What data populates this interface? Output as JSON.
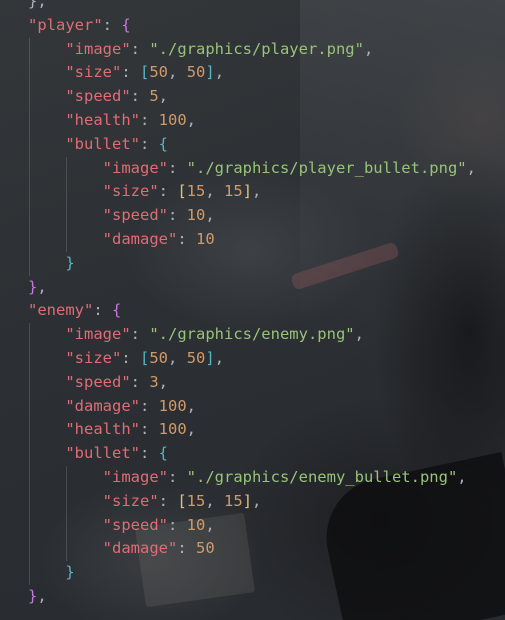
{
  "editor": {
    "lines": [
      {
        "indent": 0,
        "tokens": [
          {
            "t": "p",
            "v": "},"
          }
        ]
      },
      {
        "indent": 0,
        "tokens": [
          {
            "t": "k",
            "v": "\"player\""
          },
          {
            "t": "p",
            "v": ": "
          },
          {
            "t": "b1",
            "v": "{"
          }
        ]
      },
      {
        "indent": 1,
        "tokens": [
          {
            "t": "k",
            "v": "\"image\""
          },
          {
            "t": "p",
            "v": ": "
          },
          {
            "t": "s",
            "v": "\"./graphics/player.png\""
          },
          {
            "t": "p",
            "v": ","
          }
        ]
      },
      {
        "indent": 1,
        "tokens": [
          {
            "t": "k",
            "v": "\"size\""
          },
          {
            "t": "p",
            "v": ": "
          },
          {
            "t": "b2",
            "v": "["
          },
          {
            "t": "n",
            "v": "50"
          },
          {
            "t": "p",
            "v": ", "
          },
          {
            "t": "n",
            "v": "50"
          },
          {
            "t": "b2",
            "v": "]"
          },
          {
            "t": "p",
            "v": ","
          }
        ]
      },
      {
        "indent": 1,
        "tokens": [
          {
            "t": "k",
            "v": "\"speed\""
          },
          {
            "t": "p",
            "v": ": "
          },
          {
            "t": "n",
            "v": "5"
          },
          {
            "t": "p",
            "v": ","
          }
        ]
      },
      {
        "indent": 1,
        "tokens": [
          {
            "t": "k",
            "v": "\"health\""
          },
          {
            "t": "p",
            "v": ": "
          },
          {
            "t": "n",
            "v": "100"
          },
          {
            "t": "p",
            "v": ","
          }
        ]
      },
      {
        "indent": 1,
        "tokens": [
          {
            "t": "k",
            "v": "\"bullet\""
          },
          {
            "t": "p",
            "v": ": "
          },
          {
            "t": "b2",
            "v": "{"
          }
        ]
      },
      {
        "indent": 2,
        "tokens": [
          {
            "t": "k",
            "v": "\"image\""
          },
          {
            "t": "p",
            "v": ": "
          },
          {
            "t": "s",
            "v": "\"./graphics/player_bullet.png\""
          },
          {
            "t": "p",
            "v": ","
          }
        ]
      },
      {
        "indent": 2,
        "tokens": [
          {
            "t": "k",
            "v": "\"size\""
          },
          {
            "t": "p",
            "v": ": "
          },
          {
            "t": "b3",
            "v": "["
          },
          {
            "t": "n",
            "v": "15"
          },
          {
            "t": "p",
            "v": ", "
          },
          {
            "t": "n",
            "v": "15"
          },
          {
            "t": "b3",
            "v": "]"
          },
          {
            "t": "p",
            "v": ","
          }
        ]
      },
      {
        "indent": 2,
        "tokens": [
          {
            "t": "k",
            "v": "\"speed\""
          },
          {
            "t": "p",
            "v": ": "
          },
          {
            "t": "n",
            "v": "10"
          },
          {
            "t": "p",
            "v": ","
          }
        ]
      },
      {
        "indent": 2,
        "tokens": [
          {
            "t": "k",
            "v": "\"damage\""
          },
          {
            "t": "p",
            "v": ": "
          },
          {
            "t": "n",
            "v": "10"
          }
        ]
      },
      {
        "indent": 1,
        "tokens": [
          {
            "t": "b2",
            "v": "}"
          }
        ]
      },
      {
        "indent": 0,
        "tokens": [
          {
            "t": "b1",
            "v": "}"
          },
          {
            "t": "p",
            "v": ","
          }
        ]
      },
      {
        "indent": 0,
        "tokens": [
          {
            "t": "k",
            "v": "\"enemy\""
          },
          {
            "t": "p",
            "v": ": "
          },
          {
            "t": "b1",
            "v": "{"
          }
        ]
      },
      {
        "indent": 1,
        "tokens": [
          {
            "t": "k",
            "v": "\"image\""
          },
          {
            "t": "p",
            "v": ": "
          },
          {
            "t": "s",
            "v": "\"./graphics/enemy.png\""
          },
          {
            "t": "p",
            "v": ","
          }
        ]
      },
      {
        "indent": 1,
        "tokens": [
          {
            "t": "k",
            "v": "\"size\""
          },
          {
            "t": "p",
            "v": ": "
          },
          {
            "t": "b2",
            "v": "["
          },
          {
            "t": "n",
            "v": "50"
          },
          {
            "t": "p",
            "v": ", "
          },
          {
            "t": "n",
            "v": "50"
          },
          {
            "t": "b2",
            "v": "]"
          },
          {
            "t": "p",
            "v": ","
          }
        ]
      },
      {
        "indent": 1,
        "tokens": [
          {
            "t": "k",
            "v": "\"speed\""
          },
          {
            "t": "p",
            "v": ": "
          },
          {
            "t": "n",
            "v": "3"
          },
          {
            "t": "p",
            "v": ","
          }
        ]
      },
      {
        "indent": 1,
        "tokens": [
          {
            "t": "k",
            "v": "\"damage\""
          },
          {
            "t": "p",
            "v": ": "
          },
          {
            "t": "n",
            "v": "100"
          },
          {
            "t": "p",
            "v": ","
          }
        ]
      },
      {
        "indent": 1,
        "tokens": [
          {
            "t": "k",
            "v": "\"health\""
          },
          {
            "t": "p",
            "v": ": "
          },
          {
            "t": "n",
            "v": "100"
          },
          {
            "t": "p",
            "v": ","
          }
        ]
      },
      {
        "indent": 1,
        "tokens": [
          {
            "t": "k",
            "v": "\"bullet\""
          },
          {
            "t": "p",
            "v": ": "
          },
          {
            "t": "b2",
            "v": "{"
          }
        ]
      },
      {
        "indent": 2,
        "tokens": [
          {
            "t": "k",
            "v": "\"image\""
          },
          {
            "t": "p",
            "v": ": "
          },
          {
            "t": "s",
            "v": "\"./graphics/enemy_bullet.png\""
          },
          {
            "t": "p",
            "v": ","
          }
        ]
      },
      {
        "indent": 2,
        "tokens": [
          {
            "t": "k",
            "v": "\"size\""
          },
          {
            "t": "p",
            "v": ": "
          },
          {
            "t": "b3",
            "v": "["
          },
          {
            "t": "n",
            "v": "15"
          },
          {
            "t": "p",
            "v": ", "
          },
          {
            "t": "n",
            "v": "15"
          },
          {
            "t": "b3",
            "v": "]"
          },
          {
            "t": "p",
            "v": ","
          }
        ]
      },
      {
        "indent": 2,
        "tokens": [
          {
            "t": "k",
            "v": "\"speed\""
          },
          {
            "t": "p",
            "v": ": "
          },
          {
            "t": "n",
            "v": "10"
          },
          {
            "t": "p",
            "v": ","
          }
        ]
      },
      {
        "indent": 2,
        "tokens": [
          {
            "t": "k",
            "v": "\"damage\""
          },
          {
            "t": "p",
            "v": ": "
          },
          {
            "t": "n",
            "v": "50"
          }
        ]
      },
      {
        "indent": 1,
        "tokens": [
          {
            "t": "b2",
            "v": "}"
          }
        ]
      },
      {
        "indent": 0,
        "tokens": [
          {
            "t": "b1",
            "v": "}"
          },
          {
            "t": "p",
            "v": ","
          }
        ]
      }
    ]
  },
  "colors": {
    "key": "#e06c75",
    "string": "#98c379",
    "number": "#d19a66",
    "punctuation": "#abb2bf",
    "bracket_level1": "#c678dd",
    "bracket_level2": "#56b6c2",
    "bracket_level3": "#e5c07b"
  }
}
